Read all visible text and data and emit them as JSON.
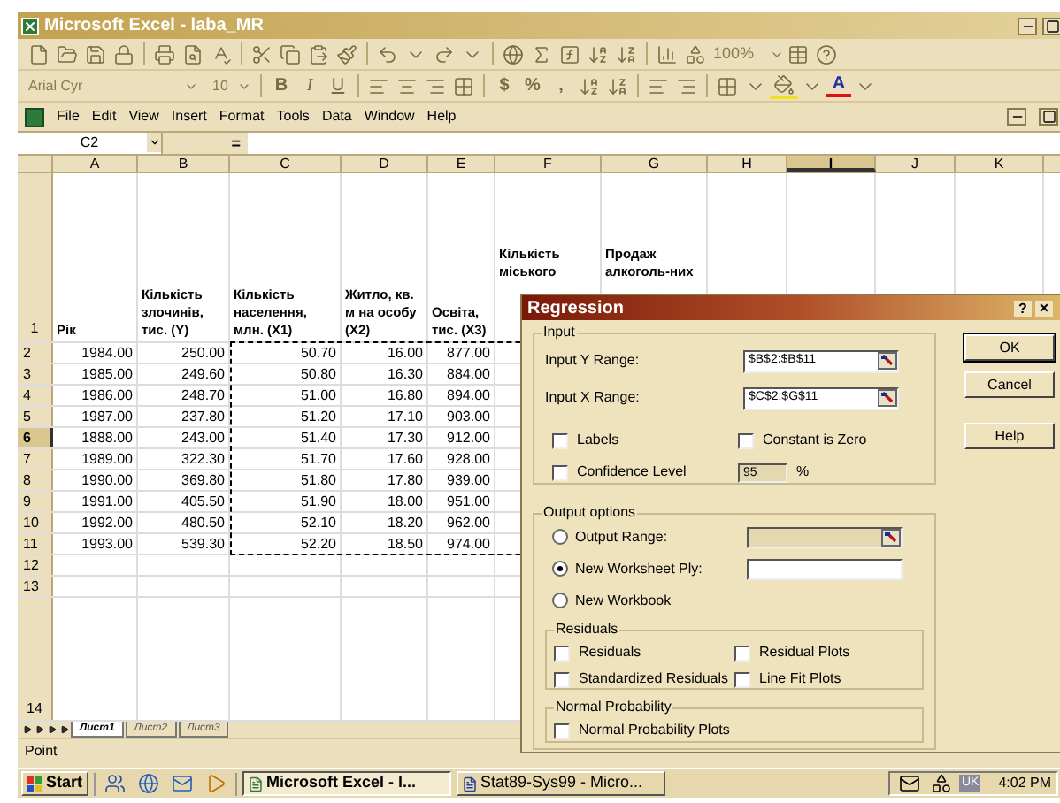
{
  "window": {
    "title": "Microsoft Excel - laba_MR"
  },
  "standard_toolbar": {
    "zoom": "100%"
  },
  "formatting_toolbar": {
    "font": "Arial Cyr",
    "font_size": "10",
    "style_buttons": [
      "B",
      "I",
      "U"
    ],
    "number_buttons": [
      "$",
      "%",
      ","
    ],
    "font_color_letter": "A"
  },
  "menu": [
    "File",
    "Edit",
    "View",
    "Insert",
    "Format",
    "Tools",
    "Data",
    "Window",
    "Help"
  ],
  "formula_bar": {
    "name_box": "C2",
    "equals": "="
  },
  "sheet": {
    "copy_marquee": true,
    "columns": [
      {
        "label": "A",
        "selected": false
      },
      {
        "label": "B",
        "selected": false
      },
      {
        "label": "C",
        "selected": false
      },
      {
        "label": "D",
        "selected": false
      },
      {
        "label": "E",
        "selected": false
      },
      {
        "label": "F",
        "selected": false
      },
      {
        "label": "G",
        "selected": false
      },
      {
        "label": "H",
        "selected": false
      },
      {
        "label": "I",
        "selected": true
      },
      {
        "label": "J",
        "selected": false
      },
      {
        "label": "K",
        "selected": false
      }
    ],
    "header_row": {
      "number": "1",
      "cells": [
        "Рік",
        "Кількість злочинів, тис. (Y)",
        "Кількість населення, млн. (X1)",
        "Житло, кв. м на особу (X2)",
        "Освіта, тис. (X3)",
        "Кількість міського",
        "Продаж алкоголь-них"
      ]
    },
    "rows": [
      {
        "number": "2",
        "selected": false,
        "cells": [
          "1984.00",
          "250.00",
          "50.70",
          "16.00",
          "877.00"
        ]
      },
      {
        "number": "3",
        "selected": false,
        "cells": [
          "1985.00",
          "249.60",
          "50.80",
          "16.30",
          "884.00"
        ]
      },
      {
        "number": "4",
        "selected": false,
        "cells": [
          "1986.00",
          "248.70",
          "51.00",
          "16.80",
          "894.00"
        ]
      },
      {
        "number": "5",
        "selected": false,
        "cells": [
          "1987.00",
          "237.80",
          "51.20",
          "17.10",
          "903.00"
        ]
      },
      {
        "number": "6",
        "selected": true,
        "cells": [
          "1888.00",
          "243.00",
          "51.40",
          "17.30",
          "912.00"
        ]
      },
      {
        "number": "7",
        "selected": false,
        "cells": [
          "1989.00",
          "322.30",
          "51.70",
          "17.60",
          "928.00"
        ]
      },
      {
        "number": "8",
        "selected": false,
        "cells": [
          "1990.00",
          "369.80",
          "51.80",
          "17.80",
          "939.00"
        ]
      },
      {
        "number": "9",
        "selected": false,
        "cells": [
          "1991.00",
          "405.50",
          "51.90",
          "18.00",
          "951.00"
        ]
      },
      {
        "number": "10",
        "selected": false,
        "cells": [
          "1992.00",
          "480.50",
          "52.10",
          "18.20",
          "962.00"
        ]
      },
      {
        "number": "11",
        "selected": false,
        "cells": [
          "1993.00",
          "539.30",
          "52.20",
          "18.50",
          "974.00"
        ]
      },
      {
        "number": "12",
        "selected": false
      },
      {
        "number": "13",
        "selected": false
      }
    ],
    "last_row": "14"
  },
  "sheet_tabs": [
    {
      "label": "Лист1",
      "selected": true
    },
    {
      "label": "Лист2",
      "selected": false
    },
    {
      "label": "Лист3",
      "selected": false
    }
  ],
  "status_bar": "Point",
  "dialog": {
    "title": "Regression",
    "help": "?",
    "close": "×",
    "input_group": "Input",
    "fields": [
      {
        "label": "Input Y Range:",
        "value": "$B$2:$B$11"
      },
      {
        "label": "Input X Range:",
        "value": "$C$2:$G$11"
      }
    ],
    "options": [
      {
        "label": "Labels",
        "checked": false
      },
      {
        "label": "Constant is Zero",
        "checked": false
      },
      {
        "label": "Confidence Level",
        "checked": false
      }
    ],
    "confidence": {
      "value": "95",
      "unit": "%"
    },
    "buttons": [
      "OK",
      "Cancel",
      "Help"
    ],
    "output_group": "Output options",
    "outputs": [
      {
        "label": "Output Range:",
        "selected": false,
        "kind": "range"
      },
      {
        "label": "New Worksheet Ply:",
        "selected": true,
        "kind": "text"
      },
      {
        "label": "New Workbook",
        "selected": false,
        "kind": "none"
      }
    ],
    "residuals_group": "Residuals",
    "residuals": [
      {
        "label": "Residuals",
        "checked": false
      },
      {
        "label": "Residual Plots",
        "checked": false
      },
      {
        "label": "Standardized Residuals",
        "checked": false
      },
      {
        "label": "Line Fit Plots",
        "checked": false
      }
    ],
    "probability_group": "Normal Probability",
    "probability": [
      {
        "label": "Normal Probability Plots",
        "checked": false
      }
    ]
  },
  "taskbar": {
    "start": "Start",
    "tasks": [
      {
        "label": "Microsoft Excel - l...",
        "selected": true
      },
      {
        "label": "Stat89-Sys99 - Micro...",
        "selected": false
      }
    ],
    "language": "UK",
    "clock": "4:02 PM"
  }
}
